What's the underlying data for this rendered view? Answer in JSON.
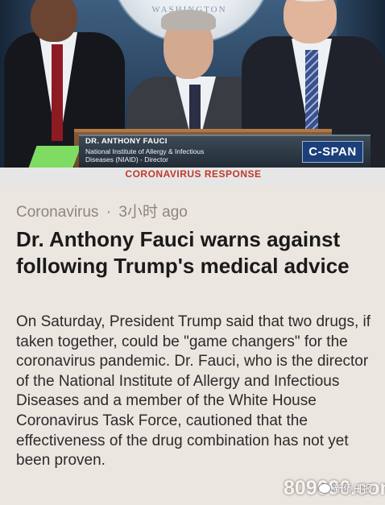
{
  "video": {
    "backdrop_text": "WASHINGTON",
    "lower_third": {
      "name": "DR. ANTHONY FAUCI",
      "org_line1": "National Institute of Allergy & Infectious",
      "org_line2": "Diseases (NIAID) - Director"
    },
    "network_logo": "C-SPAN",
    "banner": "CORONAVIRUS RESPONSE"
  },
  "article": {
    "category": "Coronavirus",
    "separator": "·",
    "time": "3小时 ago",
    "headline": "Dr. Anthony Fauci warns against following Trump's medical advice",
    "summary": "On Saturday, President Trump said that two drugs, if taken together, could be \"game changers\" for the coronavirus pandemic. Dr. Fauci, who is the director of the National Institute of Allergy and Infectious Diseases and a member of the White House Coronavirus Task Force, cautioned that the effectiveness of the drug combination has not yet been proven."
  },
  "watermark": {
    "site": "809090.com",
    "account": "新侨日报"
  }
}
